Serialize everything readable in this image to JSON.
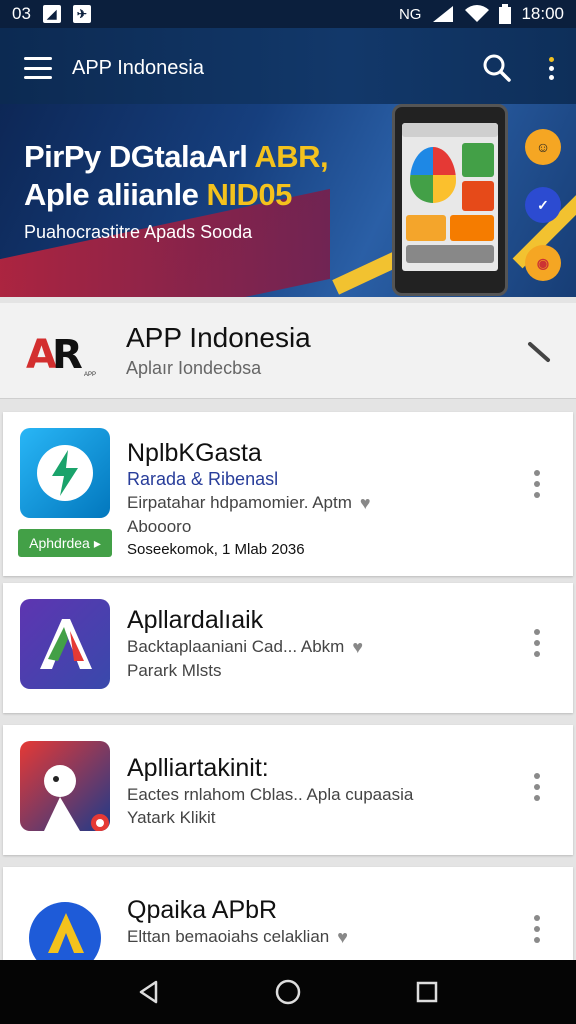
{
  "status_bar": {
    "left_text": "03",
    "time": "18:00",
    "network": "NG"
  },
  "app_bar": {
    "title": "APP Indonesia"
  },
  "banner": {
    "headline_line1_white": "PirPy DGtalaArl ",
    "headline_line1_yellow": "ABR,",
    "headline_line2_white": "Aple aliianle ",
    "headline_line2_yellow": "NID05",
    "subtitle": "Puahocrastitre Apads Sooda",
    "colors": {
      "yellow": "#f4c21d",
      "red": "#c7233a",
      "navy": "#0d2756"
    }
  },
  "header_card": {
    "logo_text_a": "A",
    "logo_text_r": "R",
    "logo_tiny": "APP",
    "title": "APP Indonesia",
    "subtitle": "Aplaır Iondecbsa"
  },
  "apps": [
    {
      "name": "NplbKGasta",
      "line1": "Rarada & Ribenasl",
      "line2": "Eirpatahar hdpamomier. Aptm",
      "line3": "Aboooro",
      "line4": "Soseekomok, 1 Mlab 2036",
      "badge": "Aphdrdea"
    },
    {
      "name": "Apllardalıaik",
      "line1": "Backtaplaaniani Cad... Abkm",
      "line2": "Parark Mlsts"
    },
    {
      "name": "Aplliartakinit:",
      "line1": "Eactes rnlahom Cblas.. Apla cupaasia",
      "line2": "Yatark Klikit"
    },
    {
      "name": "Qpaika APbR",
      "line1": "Elttan bemaoiahs celaklian"
    }
  ]
}
